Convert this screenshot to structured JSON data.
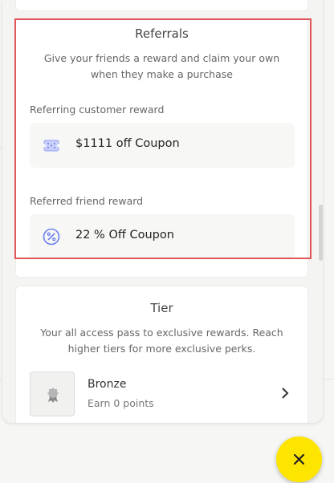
{
  "referrals": {
    "title": "Referrals",
    "description_line1": "Give your friends a reward and claim your own",
    "description_line2": "when they make a purchase",
    "referring_label": "Referring customer reward",
    "referring_reward": "$1111 off Coupon",
    "referring_icon": "coupon-ticket-icon",
    "referred_label": "Referred friend reward",
    "referred_reward": "22 % Off Coupon",
    "referred_icon": "percent-badge-icon"
  },
  "tier": {
    "title": "Tier",
    "description_line1": "Your all access pass to exclusive rewards. Reach",
    "description_line2": "higher tiers for more exclusive perks.",
    "items": [
      {
        "name": "Bronze",
        "points": "Earn 0 points",
        "icon": "medal-icon"
      }
    ]
  },
  "fab": {
    "icon": "close-icon",
    "color": "#fde500"
  },
  "colors": {
    "highlight": "#e05555",
    "accent_icon": "#6d7ff2"
  }
}
